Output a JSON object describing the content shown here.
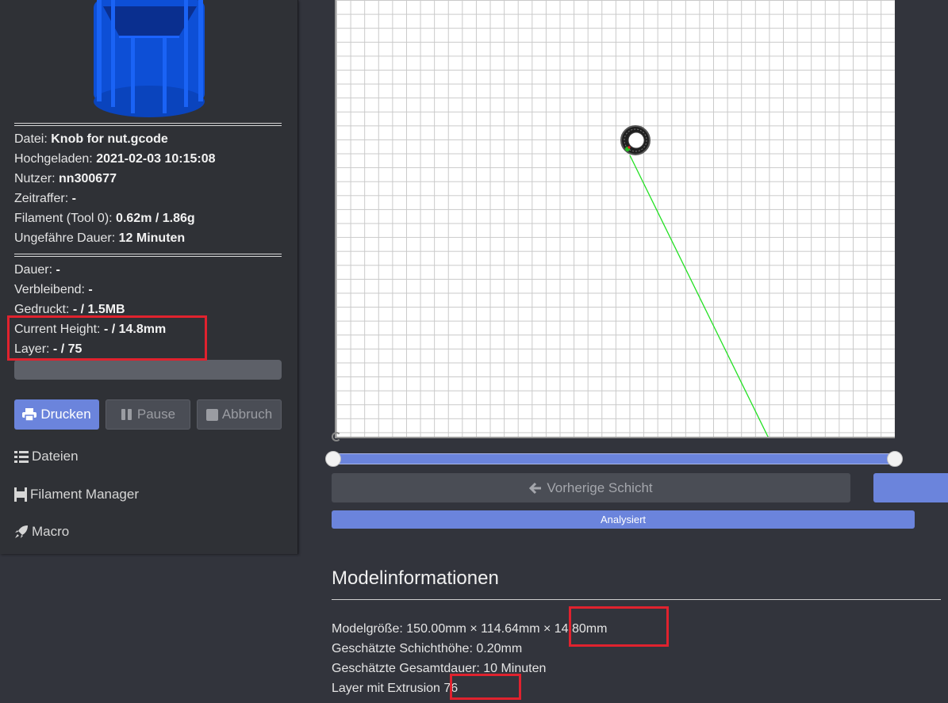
{
  "file_info": {
    "file_label": "Datei:",
    "file_value": "Knob for nut.gcode",
    "uploaded_label": "Hochgeladen:",
    "uploaded_value": "2021-02-03 10:15:08",
    "user_label": "Nutzer:",
    "user_value": "nn300677",
    "timelapse_label": "Zeitraffer:",
    "timelapse_value": "-",
    "filament_label": "Filament (Tool 0):",
    "filament_value": "0.62m / 1.86g",
    "est_duration_label": "Ungefähre Dauer:",
    "est_duration_value": "12 Minuten"
  },
  "print_status": {
    "duration_label": "Dauer:",
    "duration_value": "-",
    "remaining_label": "Verbleibend:",
    "remaining_value": "-",
    "printed_label": "Gedruckt:",
    "printed_value": "- / 1.5MB",
    "height_label": "Current Height:",
    "height_value": "- / 14.8mm",
    "layer_label": "Layer:",
    "layer_value": "- / 75",
    "progress": 0
  },
  "buttons": {
    "print": "Drucken",
    "pause": "Pause",
    "abort": "Abbruch"
  },
  "nav": {
    "files": "Dateien",
    "filament": "Filament Manager",
    "macro": "Macro"
  },
  "viewer": {
    "prev_layer": "Vorherige Schicht",
    "analysed": "Analysiert"
  },
  "model_info": {
    "title": "Modelinformationen",
    "size_label": "Modelgröße:",
    "size_value": "150.00mm × 114.64mm × 14.80mm",
    "layer_height_label": "Geschätzte Schichthöhe:",
    "layer_height_value": "0.20mm",
    "total_duration_label": "Geschätzte Gesamtdauer:",
    "total_duration_value": "10 Minuten",
    "layers_label": "Layer mit Extrusion",
    "layers_value": "76"
  },
  "colors": {
    "accent": "#6b84dc",
    "highlight": "#e0222e",
    "travel_line": "#22e022"
  },
  "icons": [
    "printer-icon",
    "pause-icon",
    "stop-icon",
    "list-icon",
    "filament-icon",
    "rocket-icon",
    "arrow-left-icon"
  ]
}
